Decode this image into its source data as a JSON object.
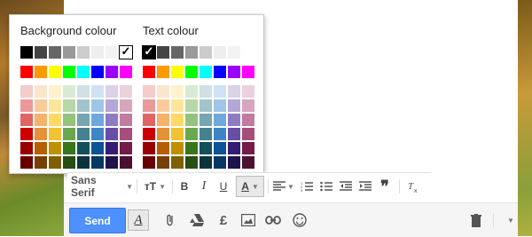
{
  "palette": {
    "bg_title": "Background colour",
    "text_title": "Text colour",
    "grays": [
      "#000000",
      "#444444",
      "#666666",
      "#999999",
      "#cccccc",
      "#eeeeee",
      "#f3f3f3",
      "#ffffff"
    ],
    "brights": [
      "#ff0000",
      "#ff9900",
      "#ffff00",
      "#00ff00",
      "#00ffff",
      "#0000ff",
      "#9900ff",
      "#ff00ff"
    ],
    "shades": [
      [
        "#f4cccc",
        "#fce5cd",
        "#fff2cc",
        "#d9ead3",
        "#d0e0e3",
        "#cfe2f3",
        "#d9d2e9",
        "#ead1dc"
      ],
      [
        "#ea9999",
        "#f9cb9c",
        "#ffe599",
        "#b6d7a8",
        "#a2c4c9",
        "#9fc5e8",
        "#b4a7d6",
        "#d5a6bd"
      ],
      [
        "#e06666",
        "#f6b26b",
        "#ffd966",
        "#93c47d",
        "#76a5af",
        "#6fa8dc",
        "#8e7cc3",
        "#c27ba0"
      ],
      [
        "#cc0000",
        "#e69138",
        "#f1c232",
        "#6aa84f",
        "#45818e",
        "#3d85c6",
        "#674ea7",
        "#a64d79"
      ],
      [
        "#990000",
        "#b45f06",
        "#bf9000",
        "#38761d",
        "#134f5c",
        "#0b5394",
        "#351c75",
        "#741b47"
      ],
      [
        "#660000",
        "#783f04",
        "#7f6000",
        "#274e13",
        "#0c343d",
        "#073763",
        "#20124d",
        "#4c1130"
      ]
    ],
    "check": "✓"
  },
  "toolbar": {
    "font_label": "Sans Serif",
    "size_label": "тT",
    "bold": "B",
    "italic": "I",
    "underline": "U",
    "text_color": "A",
    "quote": "❞"
  },
  "bottom": {
    "send_label": "Send",
    "formatting_label": "A",
    "currency_label": "£"
  }
}
